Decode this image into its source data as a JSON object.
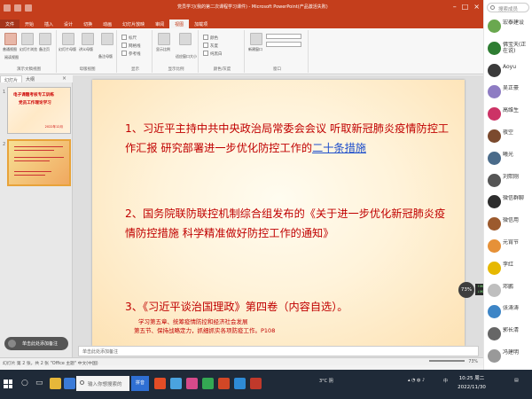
{
  "window": {
    "title": "党员学习(我的第二次课程学习课件) - Microsoft PowerPoint(产品激活失败)"
  },
  "ribbon": {
    "tabs": [
      "文件",
      "开始",
      "插入",
      "设计",
      "切换",
      "动画",
      "幻灯片放映",
      "审阅",
      "视图",
      "加载项"
    ],
    "active_tab": "视图",
    "group_presentation_views": "演示文稿视图",
    "group_master_views": "母版视图",
    "group_show": "显示",
    "btn_normal": "普通视图",
    "btn_sorter": "幻灯片浏览",
    "btn_notes": "备注页",
    "btn_reading": "阅读视图",
    "btn_slide_master": "幻灯片母版",
    "btn_handout_master": "讲义母版",
    "btn_notes_master": "备注母版",
    "chk_ruler": "标尺",
    "chk_gridlines": "网格线",
    "chk_guides": "参考线",
    "btn_zoom": "显示比例",
    "btn_fit": "适应窗口大小",
    "btn_color": "颜色",
    "btn_gray": "灰度",
    "btn_bw": "纯黑白",
    "group_zoom": "显示比例",
    "group_color": "颜色/灰度",
    "btn_new_window": "新建窗口",
    "group_window": "窗口"
  },
  "left_pane": {
    "tab_slides": "幻灯片",
    "tab_outline": "大纲",
    "close": "×",
    "thumb1_num": "1",
    "thumb1_line1": "电子课题考核专工训练",
    "thumb1_line2": "党员工作理论学习",
    "thumb1_footer": "2022年12月",
    "thumb2_num": "2",
    "voice_note": "单击此处添加备注"
  },
  "slide": {
    "item1_a": "1、习近平主持中共中央政治局常委会会议 听取新冠肺炎疫情防控工作汇报 研究部署进一步优化防控工作的",
    "item1_link": "二十条措施",
    "item2": "2、国务院联防联控机制综合组发布的《关于进一步优化新冠肺炎疫情防控措施 科学精准做好防控工作的通知》",
    "item3": "3、《习近平谈治国理政》第四卷（内容自选）。",
    "sub1": "学习第五章、统筹疫情防控和经济社会发展",
    "sub2": "第五节、保持战略定力，抓细抓实各项防疫工作。P108"
  },
  "notes_placeholder": "单击此处添加备注",
  "status": {
    "left": "幻灯片 第 2 张，共 2 张    \"Office 主题\"    中文(中国)",
    "zoom": "73%"
  },
  "overlay": {
    "zoom_bubble": "73%",
    "net_up": "↑0K/s",
    "net_down": "↓0K/s"
  },
  "participants": {
    "search_placeholder": "搜索成员",
    "items": [
      {
        "name": "宏泰建设",
        "color": "#6aa84f"
      },
      {
        "name": "佛宝天(正在说)",
        "color": "#2e7d32"
      },
      {
        "name": "Aoyu",
        "color": "#3a3a3a"
      },
      {
        "name": "吴正豪",
        "color": "#8e7cc3"
      },
      {
        "name": "高维生",
        "color": "#cc3366"
      },
      {
        "name": "夜空",
        "color": "#7b4a2e"
      },
      {
        "name": "曦光",
        "color": "#4a6b8a"
      },
      {
        "name": "刘熙刚",
        "color": "#555555"
      },
      {
        "name": "微信群聊",
        "color": "#2d2d2d"
      },
      {
        "name": "微信用",
        "color": "#9c5a2e"
      },
      {
        "name": "元宵节",
        "color": "#e69138"
      },
      {
        "name": "李红",
        "color": "#e6b800"
      },
      {
        "name": "邓鹏",
        "color": "#bfbfbf"
      },
      {
        "name": "张涛涛",
        "color": "#3d85c6"
      },
      {
        "name": "郭长清",
        "color": "#666666"
      },
      {
        "name": "冯建明",
        "color": "#999999"
      }
    ]
  },
  "taskbar": {
    "search_placeholder": "输入你想搜索的",
    "ime": "拼音",
    "tray_text": "3°C  阴",
    "time": "10:25 周二",
    "date": "2022/11/30",
    "lang": "中"
  }
}
